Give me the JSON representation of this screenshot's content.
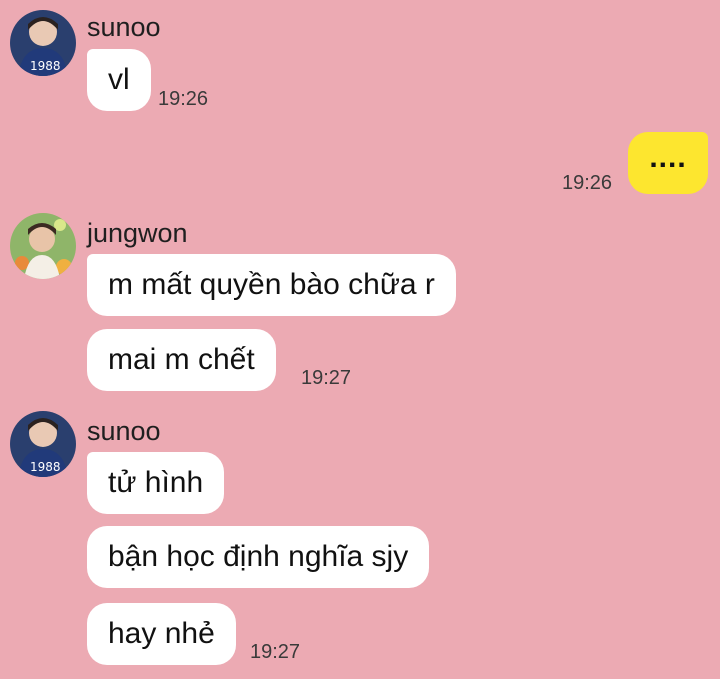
{
  "messages": [
    {
      "sender": "sunoo",
      "text": "vl",
      "time": "19:26"
    },
    {
      "sender": "me",
      "text": "....",
      "time": "19:26"
    },
    {
      "sender": "jungwon",
      "text": "m mất quyền bào chữa r"
    },
    {
      "sender": "jungwon",
      "text": "mai m chết",
      "time": "19:27"
    },
    {
      "sender": "sunoo",
      "text": "tử hình"
    },
    {
      "sender": "sunoo",
      "text": "bận học định nghĩa sjy"
    },
    {
      "sender": "sunoo",
      "text": "hay nhẻ",
      "time": "19:27"
    }
  ],
  "groups": [
    {
      "name": "sunoo",
      "avatar": "avatar-sunoo-1988-shirt"
    },
    {
      "name": "jungwon",
      "avatar": "avatar-jungwon-flowers"
    },
    {
      "name": "sunoo",
      "avatar": "avatar-sunoo-1988-shirt"
    }
  ],
  "colors": {
    "background": "#ecaab3",
    "incoming": "#ffffff",
    "outgoing": "#fde62f"
  }
}
